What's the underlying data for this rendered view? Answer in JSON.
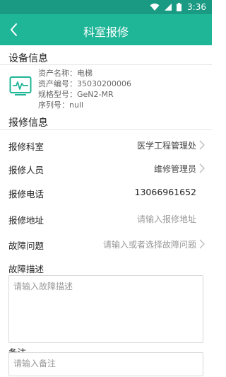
{
  "status_bar": {
    "time": "3:36",
    "icons": [
      "wifi-icon",
      "signal-icon",
      "battery-icon"
    ]
  },
  "header": {
    "title": "科室报修",
    "back_icon": "chevron-left-icon"
  },
  "device_section": {
    "heading": "设备信息",
    "icon": "monitor-icon",
    "lines": [
      "资产名称：电梯",
      "资产编号：35030200006",
      "规格型号：GeN2-MR",
      "序列号：null"
    ]
  },
  "repair_section": {
    "heading": "报修信息",
    "fields": [
      {
        "label": "报修科室",
        "value": "医学工程管理处",
        "placeholder": false,
        "chevron": true
      },
      {
        "label": "报修人员",
        "value": "维修管理员",
        "placeholder": false,
        "chevron": true
      },
      {
        "label": "报修电话",
        "value": "13066961652",
        "placeholder": false,
        "chevron": false
      },
      {
        "label": "报修地址",
        "value": "请输入报修地址",
        "placeholder": true,
        "chevron": false
      },
      {
        "label": "故障问题",
        "value": "请输入或者选择故障问题",
        "placeholder": true,
        "chevron": true
      }
    ],
    "fault_description": {
      "label": "故障描述",
      "placeholder": "请输入故障描述"
    },
    "remark": {
      "label": "备注",
      "placeholder": "请输入备注"
    }
  },
  "colors": {
    "primary": "#1fb597",
    "statusbar": "#1a9a82"
  }
}
